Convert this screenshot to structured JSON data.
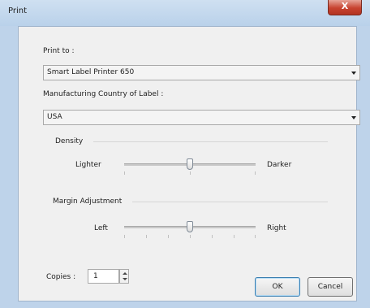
{
  "window": {
    "title": "Print",
    "close_glyph": "X"
  },
  "print_to": {
    "label": "Print to :",
    "value": "Smart Label Printer 650"
  },
  "country": {
    "label": "Manufacturing Country of Label :",
    "value": "USA"
  },
  "density": {
    "group_label": "Density",
    "left_label": "Lighter",
    "right_label": "Darker",
    "position_fraction": 0.5
  },
  "margin": {
    "group_label": "Margin Adjustment",
    "left_label": "Left",
    "right_label": "Right",
    "position_fraction": 0.5
  },
  "copies": {
    "label": "Copies :",
    "value": "1"
  },
  "buttons": {
    "ok": "OK",
    "cancel": "Cancel"
  },
  "icons": [
    "close-icon",
    "dropdown-arrow-icon",
    "spin-up-icon",
    "spin-down-icon"
  ]
}
